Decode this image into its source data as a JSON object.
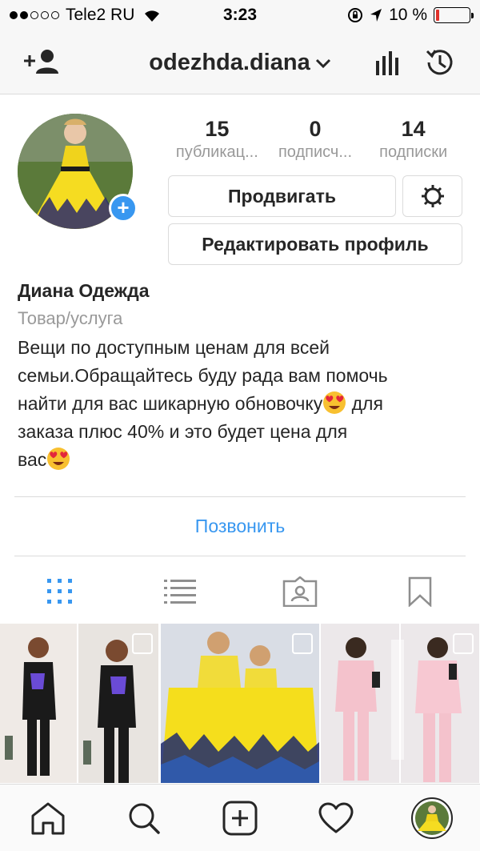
{
  "status_bar": {
    "carrier": "Tele2 RU",
    "time": "3:23",
    "battery": "10 %",
    "battery_level": 0.1
  },
  "nav": {
    "username": "odezhda.diana"
  },
  "profile": {
    "stats": [
      {
        "value": "15",
        "label": "публикац..."
      },
      {
        "value": "0",
        "label": "подписч..."
      },
      {
        "value": "14",
        "label": "подписки"
      }
    ],
    "promote_label": "Продвигать",
    "edit_label": "Редактировать профиль",
    "name": "Диана Одежда",
    "category": "Товар/услуга",
    "bio_lines": [
      "Вещи по доступным ценам для всей",
      "семьи.Обращайтесь буду рада вам помочь",
      "найти для вас шикарную обновочку",
      "для",
      "заказа плюс 40% и это будет цена для",
      "вас"
    ],
    "call_label": "Позвонить"
  },
  "tabs": [
    "grid-icon",
    "list-icon",
    "tagged-icon",
    "saved-icon"
  ],
  "colors": {
    "accent": "#3897f0",
    "text": "#262626",
    "muted": "#999999",
    "border": "#dbdbdb"
  }
}
